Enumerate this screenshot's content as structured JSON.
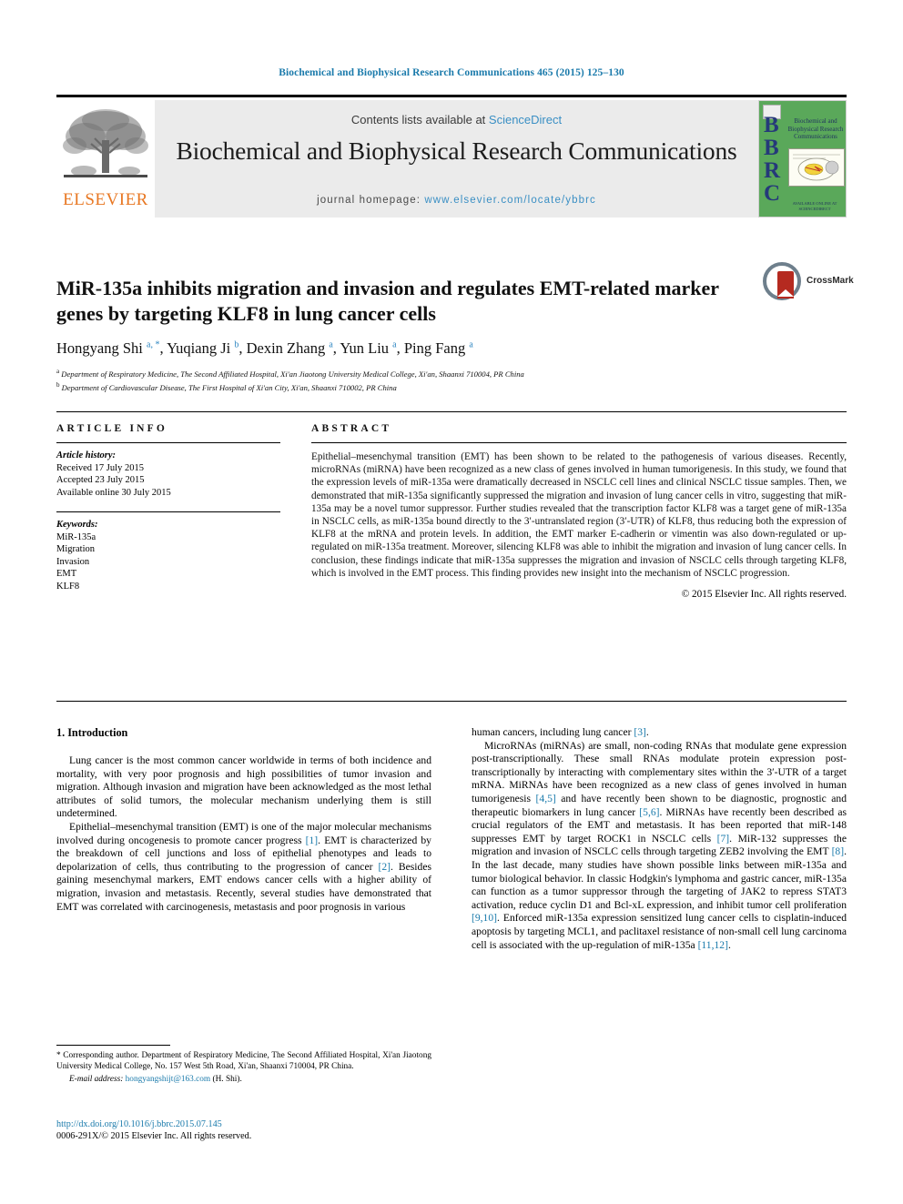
{
  "running_head": "Biochemical and Biophysical Research Communications 465 (2015) 125–130",
  "masthead": {
    "contents_prefix": "Contents lists available at ",
    "sciencedirect": "ScienceDirect",
    "journal_name": "Biochemical and Biophysical Research Communications",
    "homepage_prefix": "journal homepage: ",
    "homepage_url": "www.elsevier.com/locate/ybbrc",
    "publisher": "ELSEVIER",
    "cover": {
      "acronym": "BBRC",
      "title": "Biochemical and Biophysical Research Communications",
      "footer": "AVAILABLE ONLINE AT SCIENCEDIRECT.COM\nScienceDirect"
    },
    "accent_link_color": "#3a8fc4",
    "elsevier_orange": "#e87722",
    "cover_green": "#5aa85a"
  },
  "article": {
    "title": "MiR-135a inhibits migration and invasion and regulates EMT-related marker genes by targeting KLF8 in lung cancer cells",
    "authors_html": "Hongyang Shi <sup>a, *</sup>, Yuqiang Ji <sup>b</sup>, Dexin Zhang <sup>a</sup>, Yun Liu <sup>a</sup>, Ping Fang <sup>a</sup>",
    "affiliation_a": "Department of Respiratory Medicine, The Second Affiliated Hospital, Xi'an Jiaotong University Medical College, Xi'an, Shaanxi 710004, PR China",
    "affiliation_b": "Department of Cardiovascular Disease, The First Hospital of Xi'an City, Xi'an, Shaanxi 710002, PR China",
    "crossmark_label": "CrossMark"
  },
  "info": {
    "heading": "ARTICLE INFO",
    "history_title": "Article history:",
    "received": "Received 17 July 2015",
    "accepted": "Accepted 23 July 2015",
    "available": "Available online 30 July 2015",
    "keywords_title": "Keywords:",
    "keywords": [
      "MiR-135a",
      "Migration",
      "Invasion",
      "EMT",
      "KLF8"
    ]
  },
  "abstract": {
    "heading": "ABSTRACT",
    "text": "Epithelial–mesenchymal transition (EMT) has been shown to be related to the pathogenesis of various diseases. Recently, microRNAs (miRNA) have been recognized as a new class of genes involved in human tumorigenesis. In this study, we found that the expression levels of miR-135a were dramatically decreased in NSCLC cell lines and clinical NSCLC tissue samples. Then, we demonstrated that miR-135a significantly suppressed the migration and invasion of lung cancer cells in vitro, suggesting that miR-135a may be a novel tumor suppressor. Further studies revealed that the transcription factor KLF8 was a target gene of miR-135a in NSCLC cells, as miR-135a bound directly to the 3′-untranslated region (3′-UTR) of KLF8, thus reducing both the expression of KLF8 at the mRNA and protein levels. In addition, the EMT marker E-cadherin or vimentin was also down-regulated or up-regulated on miR-135a treatment. Moreover, silencing KLF8 was able to inhibit the migration and invasion of lung cancer cells. In conclusion, these findings indicate that miR-135a suppresses the migration and invasion of NSCLC cells through targeting KLF8, which is involved in the EMT process. This finding provides new insight into the mechanism of NSCLC progression.",
    "copyright": "© 2015 Elsevier Inc. All rights reserved."
  },
  "introduction": {
    "section_title": "1. Introduction",
    "p1": "Lung cancer is the most common cancer worldwide in terms of both incidence and mortality, with very poor prognosis and high possibilities of tumor invasion and migration. Although invasion and migration have been acknowledged as the most lethal attributes of solid tumors, the molecular mechanism underlying them is still undetermined.",
    "p2_part1": "Epithelial–mesenchymal transition (EMT) is one of the major molecular mechanisms involved during oncogenesis to promote cancer progress ",
    "p2_ref1": "[1]",
    "p2_part2": ". EMT is characterized by the breakdown of cell junctions and loss of epithelial phenotypes and leads to depolarization of cells, thus contributing to the progression of cancer ",
    "p2_ref2": "[2]",
    "p2_part3": ". Besides gaining mesenchymal markers, EMT endows cancer cells with a higher ability of migration, invasion and metastasis. Recently, several studies have demonstrated that EMT was correlated with carcinogenesis, metastasis and poor prognosis in various human cancers, including lung cancer ",
    "p2_ref3": "[3]",
    "p2_part4": ".",
    "p3_part1": "MicroRNAs (miRNAs) are small, non-coding RNAs that modulate gene expression post-transcriptionally. These small RNAs modulate protein expression post-transcriptionally by interacting with complementary sites within the 3′-UTR of a target mRNA. MiRNAs have been recognized as a new class of genes involved in human tumorigenesis ",
    "p3_ref1": "[4,5]",
    "p3_part2": " and have recently been shown to be diagnostic, prognostic and therapeutic biomarkers in lung cancer ",
    "p3_ref2": "[5,6]",
    "p3_part3": ". MiRNAs have recently been described as crucial regulators of the EMT and metastasis. It has been reported that miR-148 suppresses EMT by target ROCK1 in NSCLC cells ",
    "p3_ref3": "[7]",
    "p3_part4": ". MiR-132 suppresses the migration and invasion of NSCLC cells through targeting ZEB2 involving the EMT ",
    "p3_ref4": "[8]",
    "p3_part5": ". In the last decade, many studies have shown possible links between miR-135a and tumor biological behavior. In classic Hodgkin's lymphoma and gastric cancer, miR-135a can function as a tumor suppressor through the targeting of JAK2 to repress STAT3 activation, reduce cyclin D1 and Bcl-xL expression, and inhibit tumor cell proliferation ",
    "p3_ref5": "[9,10]",
    "p3_part6": ". Enforced miR-135a expression sensitized lung cancer cells to cisplatin-induced apoptosis by targeting MCL1, and paclitaxel resistance of non-small cell lung carcinoma cell is associated with the up-regulation of miR-135a ",
    "p3_ref6": "[11,12]",
    "p3_part7": "."
  },
  "footnote": {
    "corresponding": "* Corresponding author. Department of Respiratory Medicine, The Second Affiliated Hospital, Xi'an Jiaotong University Medical College, No. 157 West 5th Road, Xi'an, Shaanxi 710004, PR China.",
    "email_label": "E-mail address: ",
    "email": "hongyangshijt@163.com",
    "email_suffix": " (H. Shi)."
  },
  "footer": {
    "doi": "http://dx.doi.org/10.1016/j.bbrc.2015.07.145",
    "issn_line": "0006-291X/© 2015 Elsevier Inc. All rights reserved."
  }
}
